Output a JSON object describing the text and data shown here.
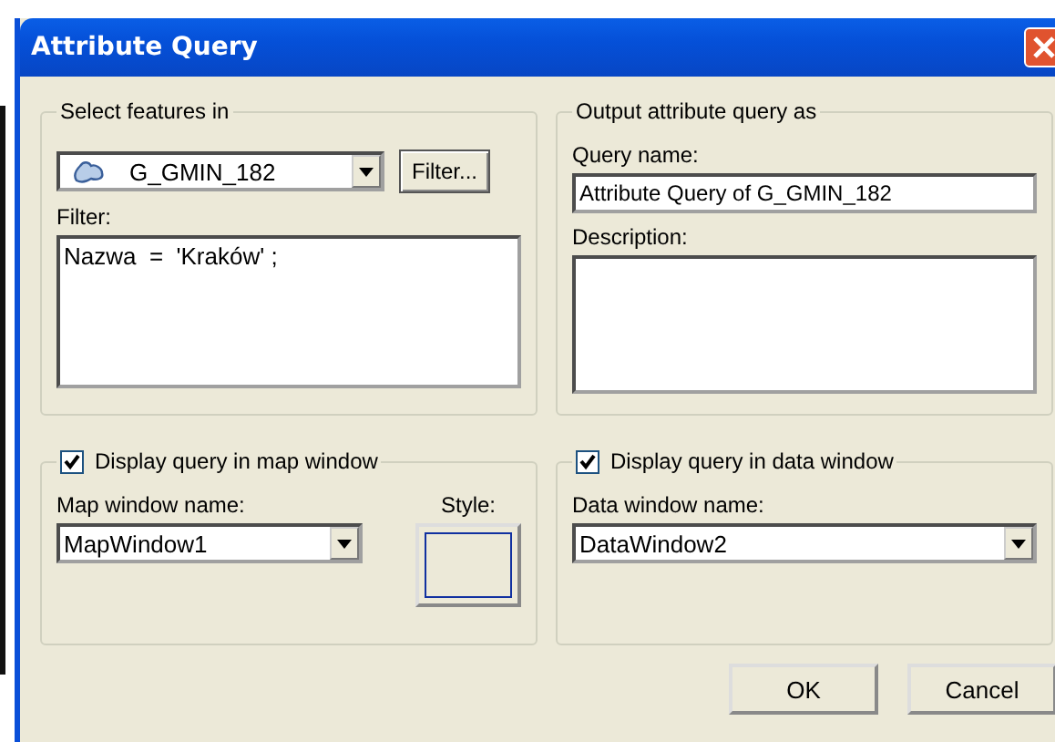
{
  "window": {
    "title": "Attribute Query"
  },
  "select_group": {
    "legend": "Select features in",
    "layer": "G_GMIN_182",
    "filter_button": "Filter...",
    "filter_label": "Filter:",
    "filter_value": "Nazwa  =  'Kraków' ;"
  },
  "output_group": {
    "legend": "Output attribute query as",
    "query_name_label": "Query name:",
    "query_name_value": "Attribute Query of G_GMIN_182",
    "description_label": "Description:"
  },
  "map_group": {
    "legend": "Display query in map window",
    "checked": true,
    "name_label": "Map window name:",
    "name_value": "MapWindow1",
    "style_label": "Style:"
  },
  "data_group": {
    "legend": "Display query in data window",
    "checked": true,
    "name_label": "Data window name:",
    "name_value": "DataWindow2"
  },
  "buttons": [
    "OK",
    "Cancel"
  ]
}
